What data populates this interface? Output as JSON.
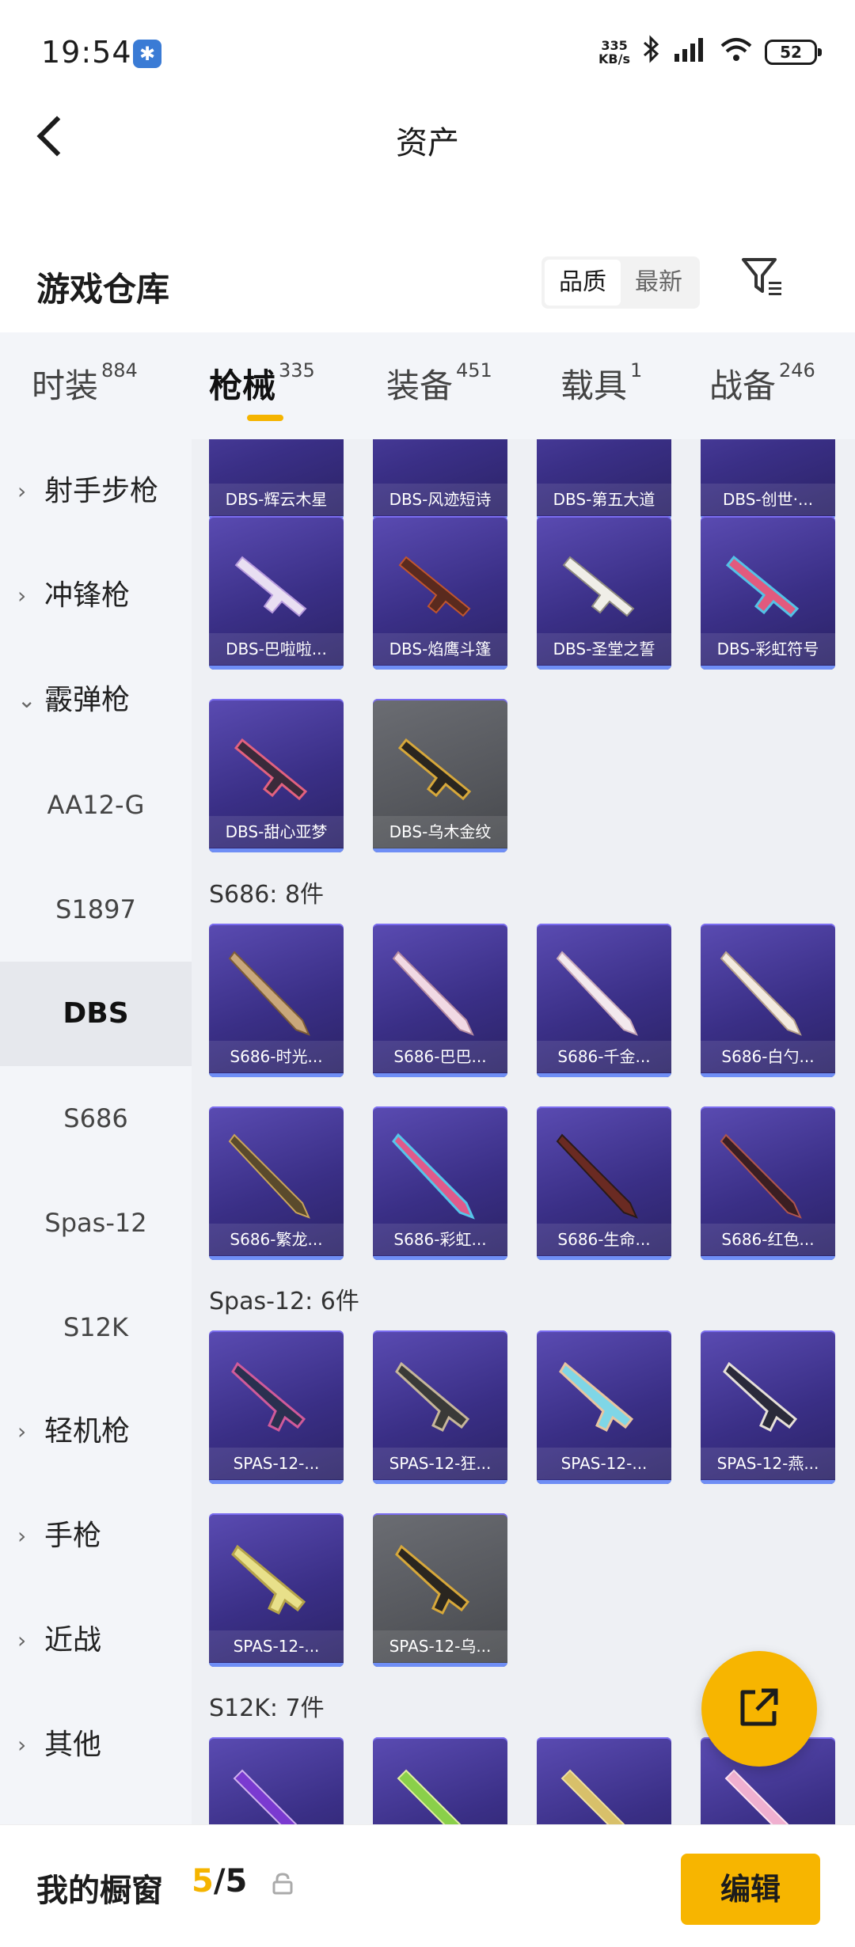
{
  "status_bar": {
    "time": "19:54",
    "app_icon": "app-badge-icon",
    "net_speed_value": "335",
    "net_speed_unit": "KB/s",
    "battery": "52"
  },
  "header": {
    "title": "资产"
  },
  "section": {
    "title": "游戏仓库",
    "sort_options": [
      "品质",
      "最新"
    ],
    "active_sort": "品质"
  },
  "tabs": [
    {
      "label": "时装",
      "count": "884"
    },
    {
      "label": "枪械",
      "count": "335"
    },
    {
      "label": "装备",
      "count": "451"
    },
    {
      "label": "载具",
      "count": "1"
    },
    {
      "label": "战备",
      "count": "246"
    }
  ],
  "active_tab": "枪械",
  "sidebar": {
    "categories": [
      {
        "label": "射手步枪",
        "expanded": false
      },
      {
        "label": "冲锋枪",
        "expanded": false
      },
      {
        "label": "霰弹枪",
        "expanded": true
      }
    ],
    "sub_items": [
      "AA12-G",
      "S1897",
      "DBS",
      "S686",
      "Spas-12",
      "S12K"
    ],
    "active_sub": "DBS",
    "more_categories": [
      "轻机枪",
      "手枪",
      "近战",
      "其他"
    ]
  },
  "groups": {
    "dbs_top_row": [
      "DBS-辉云木星",
      "DBS-风迹短诗",
      "DBS-第五大道",
      "DBS-创世·..."
    ],
    "dbs_row2": [
      "DBS-巴啦啦...",
      "DBS-焰鹰斗篷",
      "DBS-圣堂之誓",
      "DBS-彩虹符号"
    ],
    "dbs_row3": [
      "DBS-甜心亚梦",
      "DBS-乌木金纹"
    ],
    "s686": {
      "title": "S686: 8件",
      "items": [
        "S686-时光...",
        "S686-巴巴...",
        "S686-千金...",
        "S686-白勺...",
        "S686-繁龙...",
        "S686-彩虹...",
        "S686-生命...",
        "S686-红色..."
      ]
    },
    "spas12": {
      "title": "Spas-12: 6件",
      "items": [
        "SPAS-12-...",
        "SPAS-12-狂...",
        "SPAS-12-...",
        "SPAS-12-燕...",
        "SPAS-12-...",
        "SPAS-12-乌..."
      ]
    },
    "s12k": {
      "title": "S12K: 7件"
    }
  },
  "bottom_bar": {
    "label": "我的橱窗",
    "current": "5",
    "separator": "/",
    "total": "5",
    "edit_label": "编辑"
  },
  "colors": {
    "accent": "#f5b400",
    "card_purple": "#3a2f86",
    "card_grey": "#55575c"
  }
}
